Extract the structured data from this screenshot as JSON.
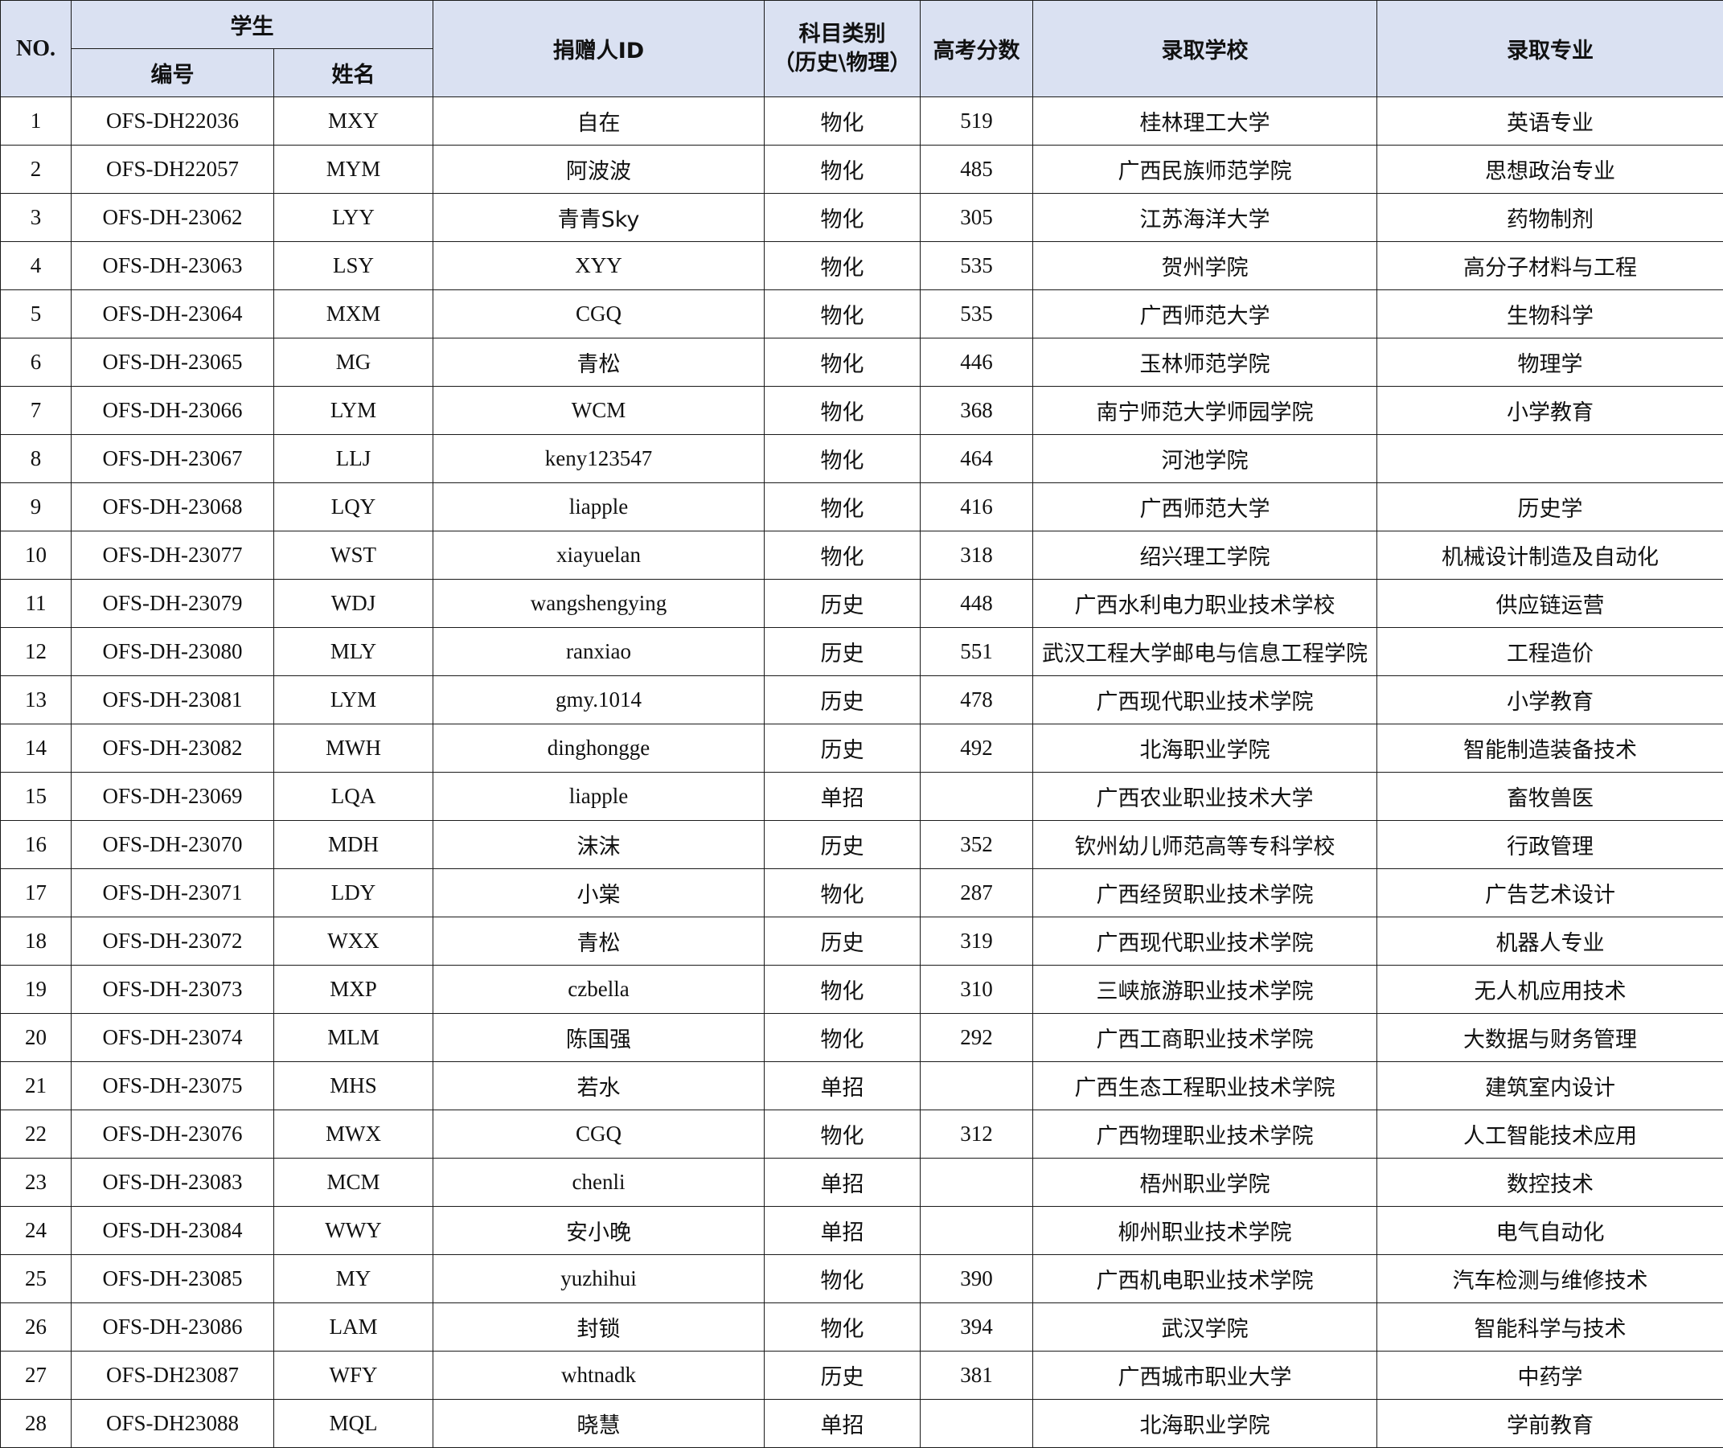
{
  "header": {
    "no": "NO.",
    "student": "学生",
    "student_id": "编号",
    "student_name": "姓名",
    "donor_id": "捐赠人ID",
    "subject_line1": "科目类别",
    "subject_line2": "（历史\\物理）",
    "score": "高考分数",
    "school": "录取学校",
    "major": "录取专业"
  },
  "rows": [
    {
      "no": "1",
      "code": "OFS-DH22036",
      "name": "MXY",
      "donor": "自在",
      "subject": "物化",
      "score": "519",
      "school": "桂林理工大学",
      "major": "英语专业"
    },
    {
      "no": "2",
      "code": "OFS-DH22057",
      "name": "MYM",
      "donor": "阿波波",
      "subject": "物化",
      "score": "485",
      "school": "广西民族师范学院",
      "major": "思想政治专业"
    },
    {
      "no": "3",
      "code": "OFS-DH-23062",
      "name": "LYY",
      "donor": "青青Sky",
      "subject": "物化",
      "score": "305",
      "school": "江苏海洋大学",
      "major": "药物制剂"
    },
    {
      "no": "4",
      "code": "OFS-DH-23063",
      "name": "LSY",
      "donor": "XYY",
      "subject": "物化",
      "score": "535",
      "school": "贺州学院",
      "major": "高分子材料与工程"
    },
    {
      "no": "5",
      "code": "OFS-DH-23064",
      "name": "MXM",
      "donor": "CGQ",
      "subject": "物化",
      "score": "535",
      "school": "广西师范大学",
      "major": "生物科学"
    },
    {
      "no": "6",
      "code": "OFS-DH-23065",
      "name": "MG",
      "donor": "青松",
      "subject": "物化",
      "score": "446",
      "school": "玉林师范学院",
      "major": "物理学"
    },
    {
      "no": "7",
      "code": "OFS-DH-23066",
      "name": "LYM",
      "donor": "WCM",
      "subject": "物化",
      "score": "368",
      "school": "南宁师范大学师园学院",
      "major": "小学教育"
    },
    {
      "no": "8",
      "code": "OFS-DH-23067",
      "name": "LLJ",
      "donor": "keny123547",
      "subject": "物化",
      "score": "464",
      "school": "河池学院",
      "major": ""
    },
    {
      "no": "9",
      "code": "OFS-DH-23068",
      "name": "LQY",
      "donor": "liapple",
      "subject": "物化",
      "score": "416",
      "school": "广西师范大学",
      "major": "历史学"
    },
    {
      "no": "10",
      "code": "OFS-DH-23077",
      "name": "WST",
      "donor": "xiayuelan",
      "subject": "物化",
      "score": "318",
      "school": "绍兴理工学院",
      "major": "机械设计制造及自动化"
    },
    {
      "no": "11",
      "code": "OFS-DH-23079",
      "name": "WDJ",
      "donor": "wangshengying",
      "subject": "历史",
      "score": "448",
      "school": "广西水利电力职业技术学校",
      "major": "供应链运营"
    },
    {
      "no": "12",
      "code": "OFS-DH-23080",
      "name": "MLY",
      "donor": "ranxiao",
      "subject": "历史",
      "score": "551",
      "school": "武汉工程大学邮电与信息工程学院",
      "major": "工程造价"
    },
    {
      "no": "13",
      "code": "OFS-DH-23081",
      "name": "LYM",
      "donor": "gmy.1014",
      "subject": "历史",
      "score": "478",
      "school": "广西现代职业技术学院",
      "major": "小学教育"
    },
    {
      "no": "14",
      "code": "OFS-DH-23082",
      "name": "MWH",
      "donor": "dinghongge",
      "subject": "历史",
      "score": "492",
      "school": "北海职业学院",
      "major": "智能制造装备技术"
    },
    {
      "no": "15",
      "code": "OFS-DH-23069",
      "name": "LQA",
      "donor": "liapple",
      "subject": "单招",
      "score": "",
      "school": "广西农业职业技术大学",
      "major": "畜牧兽医"
    },
    {
      "no": "16",
      "code": "OFS-DH-23070",
      "name": "MDH",
      "donor": "沫沫",
      "subject": "历史",
      "score": "352",
      "school": "钦州幼儿师范高等专科学校",
      "major": "行政管理"
    },
    {
      "no": "17",
      "code": "OFS-DH-23071",
      "name": "LDY",
      "donor": "小棠",
      "subject": "物化",
      "score": "287",
      "school": "广西经贸职业技术学院",
      "major": "广告艺术设计"
    },
    {
      "no": "18",
      "code": "OFS-DH-23072",
      "name": "WXX",
      "donor": "青松",
      "subject": "历史",
      "score": "319",
      "school": "广西现代职业技术学院",
      "major": "机器人专业"
    },
    {
      "no": "19",
      "code": "OFS-DH-23073",
      "name": "MXP",
      "donor": "czbella",
      "subject": "物化",
      "score": "310",
      "school": "三峡旅游职业技术学院",
      "major": "无人机应用技术"
    },
    {
      "no": "20",
      "code": "OFS-DH-23074",
      "name": "MLM",
      "donor": "陈国强",
      "subject": "物化",
      "score": "292",
      "school": "广西工商职业技术学院",
      "major": "大数据与财务管理"
    },
    {
      "no": "21",
      "code": "OFS-DH-23075",
      "name": "MHS",
      "donor": "若水",
      "subject": "单招",
      "score": "",
      "school": "广西生态工程职业技术学院",
      "major": "建筑室内设计"
    },
    {
      "no": "22",
      "code": "OFS-DH-23076",
      "name": "MWX",
      "donor": "CGQ",
      "subject": "物化",
      "score": "312",
      "school": "广西物理职业技术学院",
      "major": "人工智能技术应用"
    },
    {
      "no": "23",
      "code": "OFS-DH-23083",
      "name": "MCM",
      "donor": "chenli",
      "subject": "单招",
      "score": "",
      "school": "梧州职业学院",
      "major": "数控技术"
    },
    {
      "no": "24",
      "code": "OFS-DH-23084",
      "name": "WWY",
      "donor": "安小晚",
      "subject": "单招",
      "score": "",
      "school": "柳州职业技术学院",
      "major": "电气自动化"
    },
    {
      "no": "25",
      "code": "OFS-DH-23085",
      "name": "MY",
      "donor": "yuzhihui",
      "subject": "物化",
      "score": "390",
      "school": "广西机电职业技术学院",
      "major": "汽车检测与维修技术"
    },
    {
      "no": "26",
      "code": "OFS-DH-23086",
      "name": "LAM",
      "donor": "封锁",
      "subject": "物化",
      "score": "394",
      "school": "武汉学院",
      "major": "智能科学与技术"
    },
    {
      "no": "27",
      "code": "OFS-DH23087",
      "name": "WFY",
      "donor": "whtnadk",
      "subject": "历史",
      "score": "381",
      "school": "广西城市职业大学",
      "major": "中药学"
    },
    {
      "no": "28",
      "code": "OFS-DH23088",
      "name": "MQL",
      "donor": "晓慧",
      "subject": "单招",
      "score": "",
      "school": "北海职业学院",
      "major": "学前教育"
    }
  ]
}
